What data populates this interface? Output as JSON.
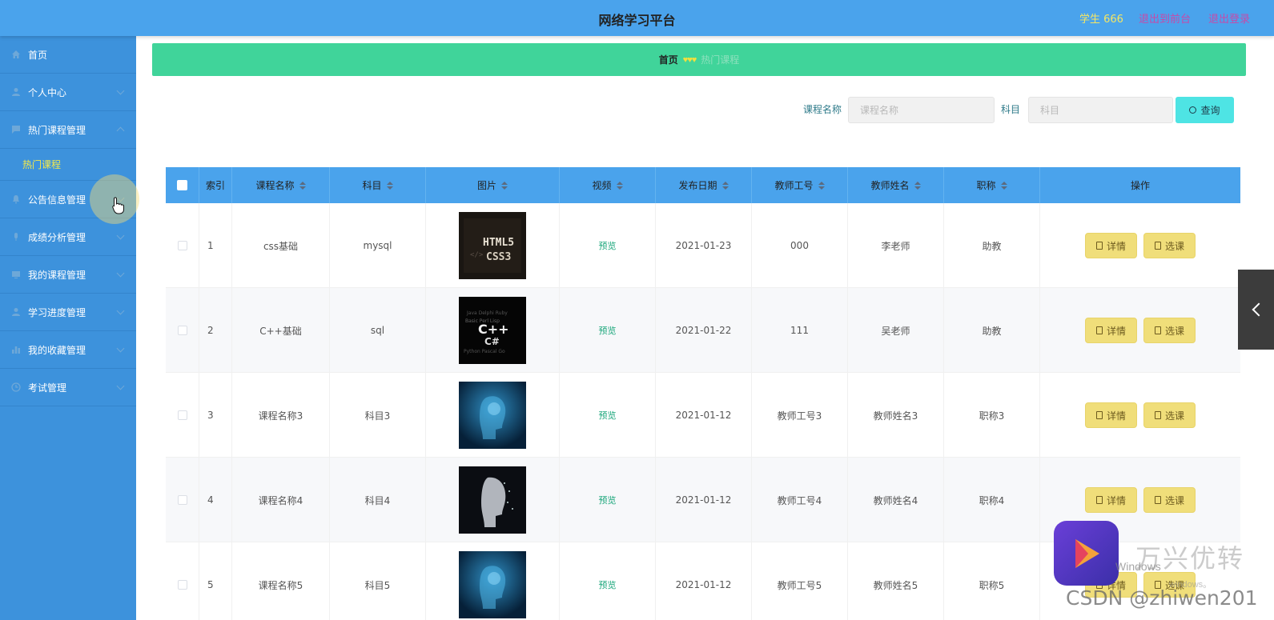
{
  "header": {
    "title": "网络学习平台",
    "user": "学生 666",
    "link_front": "退出到前台",
    "link_logout": "退出登录"
  },
  "sidebar": {
    "items": [
      {
        "label": "首页",
        "icon": "home-icon",
        "chevron": ""
      },
      {
        "label": "个人中心",
        "icon": "user-icon",
        "chevron": "down"
      },
      {
        "label": "热门课程管理",
        "icon": "flag-icon",
        "chevron": "up"
      },
      {
        "label": "公告信息管理",
        "icon": "bell-icon",
        "chevron": "down"
      },
      {
        "label": "成绩分析管理",
        "icon": "mic-icon",
        "chevron": "down"
      },
      {
        "label": "我的课程管理",
        "icon": "monitor-icon",
        "chevron": "down"
      },
      {
        "label": "学习进度管理",
        "icon": "user-icon",
        "chevron": "down"
      },
      {
        "label": "我的收藏管理",
        "icon": "bar-chart-icon",
        "chevron": "down"
      },
      {
        "label": "考试管理",
        "icon": "clock-icon",
        "chevron": "down"
      }
    ],
    "sub_item": "热门课程"
  },
  "breadcrumb": {
    "home": "首页",
    "separator": "♥♥♥",
    "current": "热门课程"
  },
  "search": {
    "course_label": "课程名称",
    "course_placeholder": "课程名称",
    "subject_label": "科目",
    "subject_placeholder": "科目",
    "button_label": "查询"
  },
  "table": {
    "columns": [
      "索引",
      "课程名称",
      "科目",
      "图片",
      "视频",
      "发布日期",
      "教师工号",
      "教师姓名",
      "职称",
      "操作"
    ],
    "rows": [
      {
        "index": "1",
        "course": "css基础",
        "subject": "mysql",
        "image": "html5-css3",
        "video": "预览",
        "date": "2021-01-23",
        "teacher_id": "000",
        "teacher_name": "李老师",
        "title": "助教"
      },
      {
        "index": "2",
        "course": "C++基础",
        "subject": "sql",
        "image": "cpp-wordcloud",
        "video": "预览",
        "date": "2021-01-22",
        "teacher_id": "111",
        "teacher_name": "吴老师",
        "title": "助教"
      },
      {
        "index": "3",
        "course": "课程名称3",
        "subject": "科目3",
        "image": "ai-head-blue",
        "video": "预览",
        "date": "2021-01-12",
        "teacher_id": "教师工号3",
        "teacher_name": "教师姓名3",
        "title": "职称3"
      },
      {
        "index": "4",
        "course": "课程名称4",
        "subject": "科目4",
        "image": "ai-head-white",
        "video": "预览",
        "date": "2021-01-12",
        "teacher_id": "教师工号4",
        "teacher_name": "教师姓名4",
        "title": "职称4"
      },
      {
        "index": "5",
        "course": "课程名称5",
        "subject": "科目5",
        "image": "ai-head-blue",
        "video": "预览",
        "date": "2021-01-12",
        "teacher_id": "教师工号5",
        "teacher_name": "教师姓名5",
        "title": "职称5"
      }
    ],
    "btn_detail": "详情",
    "btn_select": "选课"
  },
  "watermark": {
    "brand": "万兴优转",
    "windows": "Windows",
    "windows_sub": "windows。",
    "csdn": "CSDN @zhiwen201"
  },
  "colors": {
    "header": "#4aa3ec",
    "sidebar": "#3d92dc",
    "breadcrumb": "#40d49a",
    "search_button": "#4ee4e4",
    "action_button": "#f0de7a"
  }
}
